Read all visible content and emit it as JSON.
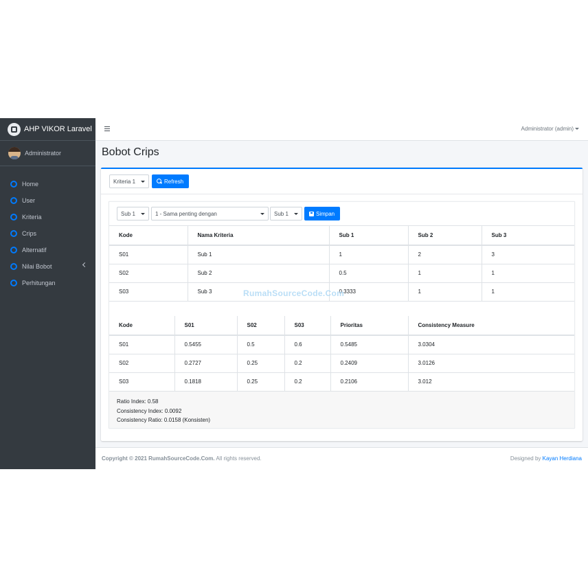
{
  "app": {
    "brand": "AHP VIKOR Laravel",
    "user_name": "Administrator"
  },
  "sidebar": {
    "items": [
      {
        "label": "Home"
      },
      {
        "label": "User"
      },
      {
        "label": "Kriteria"
      },
      {
        "label": "Crips"
      },
      {
        "label": "Alternatif"
      },
      {
        "label": "Nilai Bobot"
      },
      {
        "label": "Perhitungan"
      }
    ]
  },
  "topbar": {
    "admin_label": "Administrator (admin)"
  },
  "page": {
    "title": "Bobot Crips"
  },
  "filter": {
    "kriteria_value": "Kriteria 1",
    "refresh_label": "Refresh"
  },
  "compare": {
    "left_value": "Sub 1",
    "scale_value": "1 - Sama penting dengan",
    "right_value": "Sub 1",
    "save_label": "Simpan"
  },
  "matrix": {
    "headers": [
      "Kode",
      "Nama Kriteria",
      "Sub 1",
      "Sub 2",
      "Sub 3"
    ],
    "rows": [
      [
        "S01",
        "Sub 1",
        "1",
        "2",
        "3"
      ],
      [
        "S02",
        "Sub 2",
        "0.5",
        "1",
        "1"
      ],
      [
        "S03",
        "Sub 3",
        "0.3333",
        "1",
        "1"
      ]
    ]
  },
  "normalized": {
    "headers": [
      "Kode",
      "S01",
      "S02",
      "S03",
      "Prioritas",
      "Consistency Measure"
    ],
    "rows": [
      [
        "S01",
        "0.5455",
        "0.5",
        "0.6",
        "0.5485",
        "3.0304"
      ],
      [
        "S02",
        "0.2727",
        "0.25",
        "0.2",
        "0.2409",
        "3.0126"
      ],
      [
        "S03",
        "0.1818",
        "0.25",
        "0.2",
        "0.2106",
        "3.012"
      ]
    ]
  },
  "summary": {
    "ratio_index": "Ratio Index: 0.58",
    "consistency_index": "Consistency Index: 0.0092",
    "consistency_ratio": "Consistency Ratio: 0.0158 (Konsisten)"
  },
  "watermark": "RumahSourceCode.Com",
  "footer": {
    "copyright_bold": "Copyright © 2021 RumahSourceCode.Com.",
    "copyright_rest": " All rights reserved.",
    "designed_prefix": "Designed by ",
    "designed_link": "Kayan Herdiana"
  }
}
